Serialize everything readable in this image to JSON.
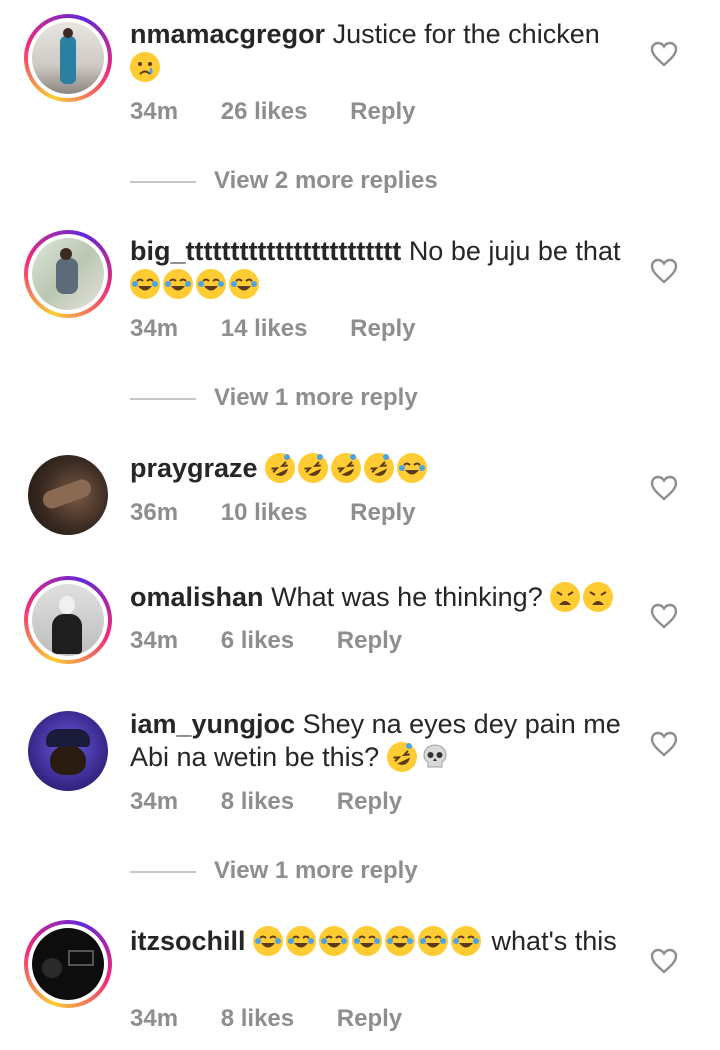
{
  "comments": [
    {
      "username": "nmamacgregor",
      "text": "Justice for the chicken",
      "emojis": [
        "crying-face"
      ],
      "time": "34m",
      "likes": "26 likes",
      "reply": "Reply",
      "view_more": "View 2 more replies",
      "ring": true,
      "avatar_color": "#d9d6d1"
    },
    {
      "username": "big_tttttttttttttttttttttttt",
      "text": "No be juju be that",
      "emojis": [
        "tears-of-joy",
        "tears-of-joy",
        "tears-of-joy",
        "tears-of-joy"
      ],
      "time": "34m",
      "likes": "14 likes",
      "reply": "Reply",
      "view_more": "View 1 more reply",
      "ring": true,
      "avatar_color": "#c9d3c6"
    },
    {
      "username": "praygraze",
      "text": "",
      "emojis": [
        "rolling-laughing",
        "rolling-laughing",
        "rolling-laughing",
        "rolling-laughing",
        "tears-of-joy"
      ],
      "time": "36m",
      "likes": "10 likes",
      "reply": "Reply",
      "ring": false,
      "avatar_color": "#3a2a22"
    },
    {
      "username": "omalishan",
      "text": "What was he thinking?",
      "emojis": [
        "weary-face",
        "weary-face"
      ],
      "time": "34m",
      "likes": "6 likes",
      "reply": "Reply",
      "ring": true,
      "avatar_color": "#bdbdbd"
    },
    {
      "username": "iam_yungjoc",
      "text": "Shey na eyes dey pain me Abi na wetin be this?",
      "emojis": [
        "rolling-laughing",
        "skull"
      ],
      "time": "34m",
      "likes": "8 likes",
      "reply": "Reply",
      "view_more": "View 1 more reply",
      "ring": false,
      "avatar_color": "#3b2a8f"
    },
    {
      "username": "itzsochill",
      "text_before": "",
      "emojis": [
        "tears-of-joy",
        "tears-of-joy",
        "tears-of-joy",
        "tears-of-joy",
        "tears-of-joy",
        "tears-of-joy",
        "tears-of-joy"
      ],
      "text_after": "what's this",
      "time": "34m",
      "likes": "8 likes",
      "reply": "Reply",
      "ring": true,
      "avatar_color": "#111111"
    }
  ],
  "icons": {
    "heart": "heart-outline-icon"
  },
  "colors": {
    "text": "#262626",
    "meta": "#8e8e8e",
    "emoji_yellow": "#ffcc33"
  }
}
